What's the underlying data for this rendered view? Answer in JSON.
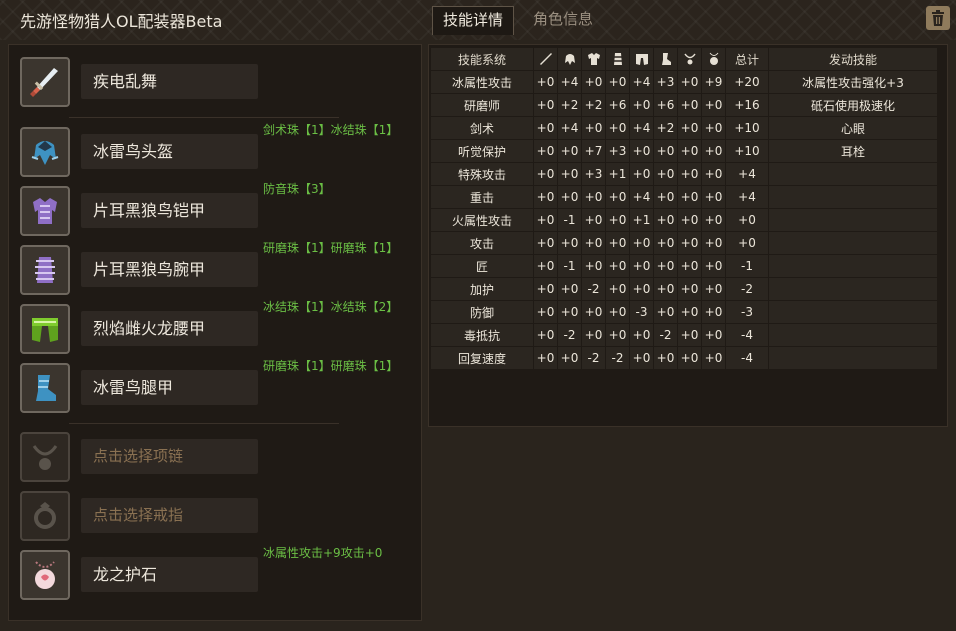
{
  "app": {
    "title": "先游怪物猎人OL配装器Beta",
    "tabs": [
      {
        "label": "技能详情",
        "active": true
      },
      {
        "label": "角色信息",
        "active": false
      }
    ],
    "trash_icon": "trash-icon"
  },
  "equipment": {
    "weapon": {
      "name": "疾电乱舞",
      "icon": "blade-weapon-icon",
      "color": "#d8634c"
    },
    "armor": [
      {
        "name": "冰雷鸟头盔",
        "note": "剑术珠【1】冰结珠【1】",
        "icon": "helmet-icon",
        "color": "#3e92c2"
      },
      {
        "name": "片耳黑狼鸟铠甲",
        "note": "防音珠【3】",
        "icon": "chest-armor-icon",
        "color": "#8f6fc6"
      },
      {
        "name": "片耳黑狼鸟腕甲",
        "note": "研磨珠【1】研磨珠【1】",
        "icon": "gauntlet-icon",
        "color": "#8f6fc6"
      },
      {
        "name": "烈焰雌火龙腰甲",
        "note": "冰结珠【1】冰结珠【2】",
        "icon": "waist-armor-icon",
        "color": "#7fcb2e"
      },
      {
        "name": "冰雷鸟腿甲",
        "note": "研磨珠【1】研磨珠【1】",
        "icon": "leg-armor-icon",
        "color": "#3e92c2"
      }
    ],
    "necklace": {
      "placeholder": "点击选择项链",
      "icon": "necklace-icon"
    },
    "ring": {
      "placeholder": "点击选择戒指",
      "icon": "ring-icon"
    },
    "talisman": {
      "name": "龙之护石",
      "note": "冰属性攻击+9攻击+0",
      "icon": "talisman-icon",
      "color": "#e06a7a"
    }
  },
  "skills_table": {
    "header": {
      "name": "技能系统",
      "slot_icons": [
        "weapon-col-icon",
        "helmet-col-icon",
        "chest-col-icon",
        "arm-col-icon",
        "waist-col-icon",
        "leg-col-icon",
        "necklace-col-icon",
        "talisman-col-icon"
      ],
      "total": "总计",
      "active": "发动技能"
    },
    "rows": [
      {
        "name": "冰属性攻击",
        "vals": [
          "+0",
          "+4",
          "+0",
          "+0",
          "+4",
          "+3",
          "+0",
          "+9"
        ],
        "total": "+20",
        "active": "冰属性攻击强化+3"
      },
      {
        "name": "研磨师",
        "vals": [
          "+0",
          "+2",
          "+2",
          "+6",
          "+0",
          "+6",
          "+0",
          "+0"
        ],
        "total": "+16",
        "active": "砥石使用极速化"
      },
      {
        "name": "剑术",
        "vals": [
          "+0",
          "+4",
          "+0",
          "+0",
          "+4",
          "+2",
          "+0",
          "+0"
        ],
        "total": "+10",
        "active": "心眼"
      },
      {
        "name": "听觉保护",
        "vals": [
          "+0",
          "+0",
          "+7",
          "+3",
          "+0",
          "+0",
          "+0",
          "+0"
        ],
        "total": "+10",
        "active": "耳栓"
      },
      {
        "name": "特殊攻击",
        "vals": [
          "+0",
          "+0",
          "+3",
          "+1",
          "+0",
          "+0",
          "+0",
          "+0"
        ],
        "total": "+4",
        "active": ""
      },
      {
        "name": "重击",
        "vals": [
          "+0",
          "+0",
          "+0",
          "+0",
          "+4",
          "+0",
          "+0",
          "+0"
        ],
        "total": "+4",
        "active": ""
      },
      {
        "name": "火属性攻击",
        "vals": [
          "+0",
          "-1",
          "+0",
          "+0",
          "+1",
          "+0",
          "+0",
          "+0"
        ],
        "total": "+0",
        "active": ""
      },
      {
        "name": "攻击",
        "vals": [
          "+0",
          "+0",
          "+0",
          "+0",
          "+0",
          "+0",
          "+0",
          "+0"
        ],
        "total": "+0",
        "active": ""
      },
      {
        "name": "匠",
        "vals": [
          "+0",
          "-1",
          "+0",
          "+0",
          "+0",
          "+0",
          "+0",
          "+0"
        ],
        "total": "-1",
        "active": ""
      },
      {
        "name": "加护",
        "vals": [
          "+0",
          "+0",
          "-2",
          "+0",
          "+0",
          "+0",
          "+0",
          "+0"
        ],
        "total": "-2",
        "active": ""
      },
      {
        "name": "防御",
        "vals": [
          "+0",
          "+0",
          "+0",
          "+0",
          "-3",
          "+0",
          "+0",
          "+0"
        ],
        "total": "-3",
        "active": ""
      },
      {
        "name": "毒抵抗",
        "vals": [
          "+0",
          "-2",
          "+0",
          "+0",
          "+0",
          "-2",
          "+0",
          "+0"
        ],
        "total": "-4",
        "active": ""
      },
      {
        "name": "回复速度",
        "vals": [
          "+0",
          "+0",
          "-2",
          "-2",
          "+0",
          "+0",
          "+0",
          "+0"
        ],
        "total": "-4",
        "active": ""
      }
    ]
  }
}
